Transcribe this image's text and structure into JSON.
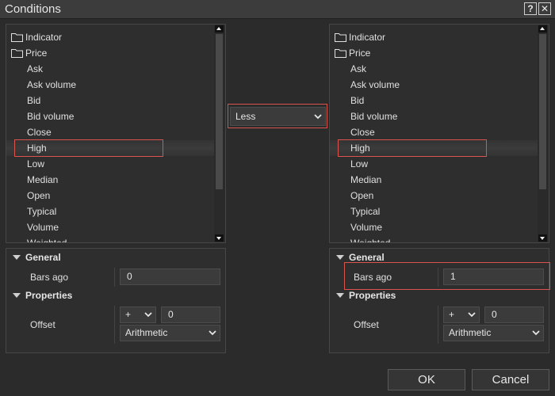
{
  "window": {
    "title": "Conditions",
    "help_label": "?",
    "close_label": "✕"
  },
  "left_tree": {
    "items": [
      {
        "label": "Indicator",
        "type": "folder"
      },
      {
        "label": "Price",
        "type": "folder"
      },
      {
        "label": "Ask",
        "type": "leaf"
      },
      {
        "label": "Ask volume",
        "type": "leaf"
      },
      {
        "label": "Bid",
        "type": "leaf"
      },
      {
        "label": "Bid volume",
        "type": "leaf"
      },
      {
        "label": "Close",
        "type": "leaf"
      },
      {
        "label": "High",
        "type": "leaf",
        "selected": true
      },
      {
        "label": "Low",
        "type": "leaf"
      },
      {
        "label": "Median",
        "type": "leaf"
      },
      {
        "label": "Open",
        "type": "leaf"
      },
      {
        "label": "Typical",
        "type": "leaf"
      },
      {
        "label": "Volume",
        "type": "leaf"
      },
      {
        "label": "Weighted",
        "type": "leaf"
      }
    ]
  },
  "right_tree": {
    "items": [
      {
        "label": "Indicator",
        "type": "folder"
      },
      {
        "label": "Price",
        "type": "folder"
      },
      {
        "label": "Ask",
        "type": "leaf"
      },
      {
        "label": "Ask volume",
        "type": "leaf"
      },
      {
        "label": "Bid",
        "type": "leaf"
      },
      {
        "label": "Bid volume",
        "type": "leaf"
      },
      {
        "label": "Close",
        "type": "leaf"
      },
      {
        "label": "High",
        "type": "leaf",
        "selected": true
      },
      {
        "label": "Low",
        "type": "leaf"
      },
      {
        "label": "Median",
        "type": "leaf"
      },
      {
        "label": "Open",
        "type": "leaf"
      },
      {
        "label": "Typical",
        "type": "leaf"
      },
      {
        "label": "Volume",
        "type": "leaf"
      },
      {
        "label": "Weighted",
        "type": "leaf"
      }
    ]
  },
  "operator": {
    "selected": "Less"
  },
  "left_props": {
    "general_label": "General",
    "bars_ago_label": "Bars ago",
    "bars_ago_value": "0",
    "properties_label": "Properties",
    "offset_label": "Offset",
    "offset_sign": "+",
    "offset_value": "0",
    "offset_type": "Arithmetic"
  },
  "right_props": {
    "general_label": "General",
    "bars_ago_label": "Bars ago",
    "bars_ago_value": "1",
    "properties_label": "Properties",
    "offset_label": "Offset",
    "offset_sign": "+",
    "offset_value": "0",
    "offset_type": "Arithmetic"
  },
  "buttons": {
    "ok": "OK",
    "cancel": "Cancel"
  },
  "colors": {
    "highlight": "#d9534f",
    "background": "#2b2b2b"
  }
}
